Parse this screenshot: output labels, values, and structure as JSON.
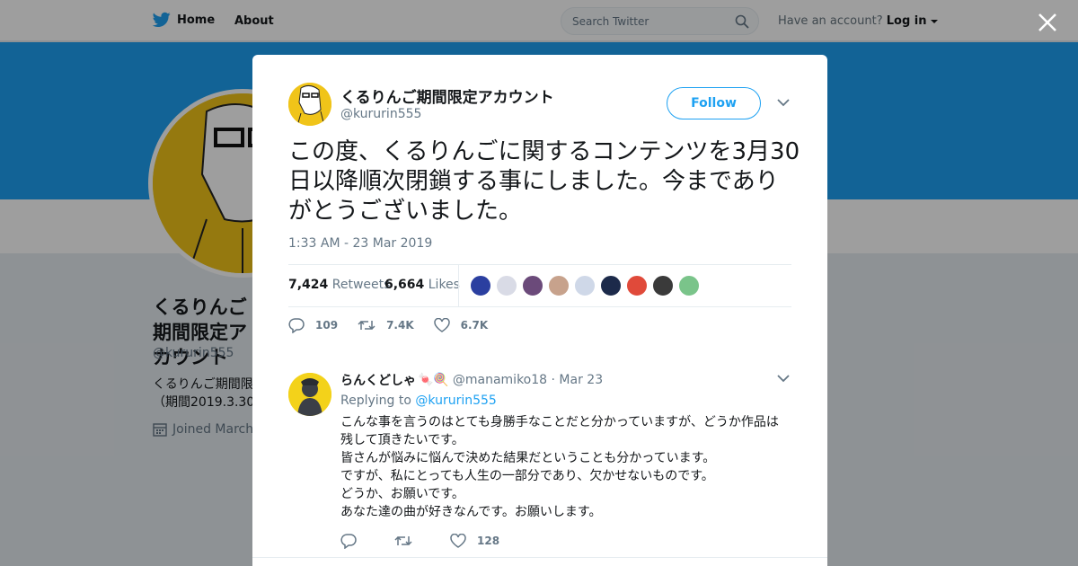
{
  "nav": {
    "home_label": "Home",
    "about_label": "About",
    "search_placeholder": "Search Twitter",
    "account_prompt": "Have an account?",
    "login_label": "Log in"
  },
  "profile_bg": {
    "name_partial": "くるりんご期間限定アカウント",
    "handle": "@kururin555",
    "bio_line1": "くるりんご期間限",
    "bio_line2": "（期間2019.3.30ま",
    "joined": "Joined March"
  },
  "tweet": {
    "author_name": "くるりんご期間限定アカウント",
    "author_handle": "@kururin555",
    "follow_label": "Follow",
    "text": "この度、くるりんごに関するコンテンツを3月30日以降順次閉鎖する事にしました。今までありがとうございました。",
    "timestamp": "1:33 AM - 23 Mar 2019",
    "retweets_count": "7,424",
    "retweets_label": "Retweets",
    "likes_count": "6,664",
    "likes_label": "Likes",
    "likers": [
      "#2b3fa0",
      "#d9dbe6",
      "#6b4a7a",
      "#c7a28c",
      "#cfd8e8",
      "#1c2a4a",
      "#e04a3a",
      "#3a3a3a",
      "#7ac48a"
    ],
    "reply_count": "109",
    "retweet_action_count": "7.4K",
    "like_action_count": "6.7K"
  },
  "reply": {
    "name": "らんくどしゃ",
    "emoji": "🍬🍭",
    "handle": "@manamiko18",
    "date": "· Mar 23",
    "replying_to_label": "Replying to",
    "replying_to_handle": "@kururin555",
    "lines": [
      "こんな事を言うのはとても身勝手なことだと分かっていますが、どうか作品は",
      "残して頂きたいです。",
      "皆さんが悩みに悩んで決めた結果だということも分かっています。",
      "ですが、私にとっても人生の一部分であり、欠かせないものです。",
      "どうか、お願いです。",
      "あなた達の曲が好きなんです。お願いします。"
    ],
    "reply_count": "",
    "retweet_count": "",
    "like_count": "128"
  },
  "colors": {
    "twitter_blue": "#1da1f2",
    "text_dark": "#14171a",
    "text_muted": "#657786",
    "avatar_yellow": "#f0c419"
  }
}
